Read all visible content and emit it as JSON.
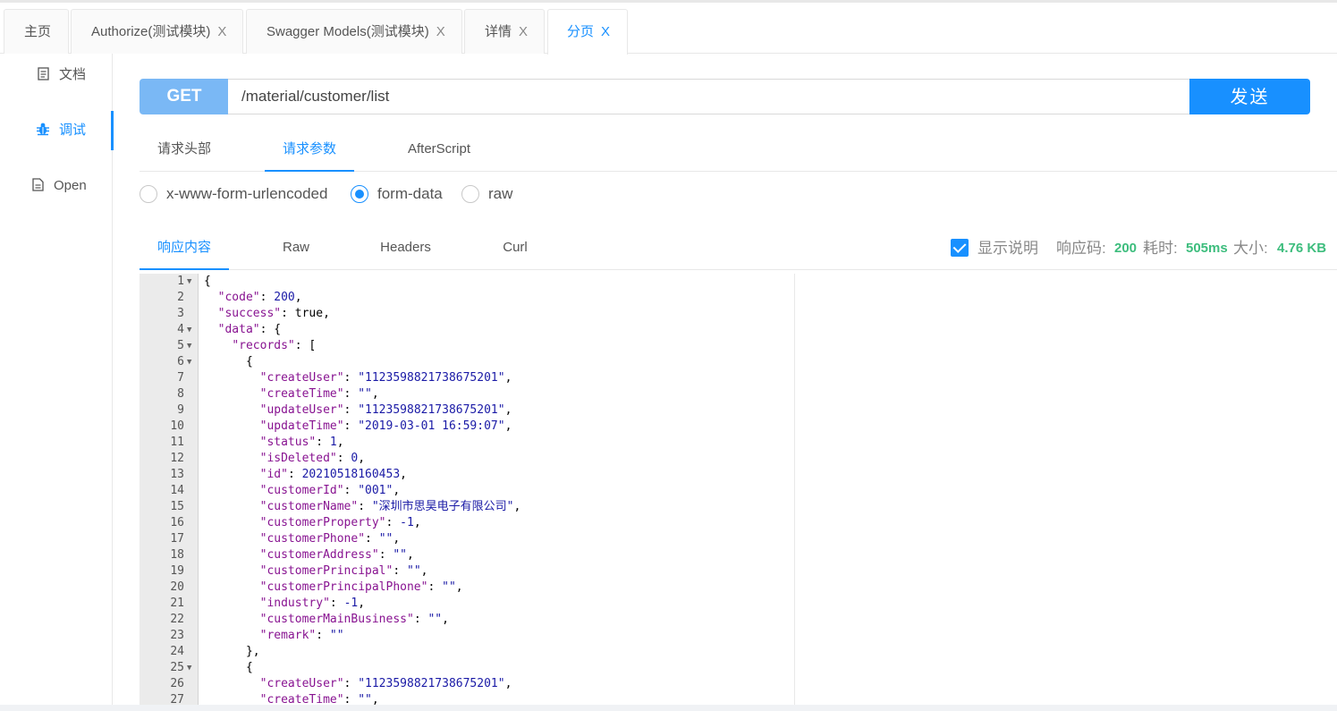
{
  "tabs": [
    {
      "label": "主页",
      "closable": false
    },
    {
      "label": "Authorize(测试模块)",
      "closable": true
    },
    {
      "label": "Swagger Models(测试模块)",
      "closable": true
    },
    {
      "label": "详情",
      "closable": true
    },
    {
      "label": "分页",
      "closable": true,
      "active": true
    }
  ],
  "close_glyph": "X",
  "sidebar": {
    "items": [
      {
        "label": "文档",
        "icon": "document-icon"
      },
      {
        "label": "调试",
        "icon": "bug-icon",
        "active": true
      },
      {
        "label": "Open",
        "icon": "file-icon"
      }
    ]
  },
  "request": {
    "method": "GET",
    "url": "/material/customer/list",
    "send_label": "发送"
  },
  "request_tabs": [
    "请求头部",
    "请求参数",
    "AfterScript"
  ],
  "body_types": [
    {
      "label": "x-www-form-urlencoded",
      "checked": false
    },
    {
      "label": "form-data",
      "checked": true
    },
    {
      "label": "raw",
      "checked": false
    }
  ],
  "response_tabs": [
    "响应内容",
    "Raw",
    "Headers",
    "Curl"
  ],
  "response_info": {
    "show_desc_label": "显示说明",
    "show_desc_checked": true,
    "code_label": "响应码:",
    "code": "200",
    "time_label": "耗时:",
    "time": "505ms",
    "size_label": "大小:",
    "size": "4.76 KB"
  },
  "colors": {
    "accent": "#1890ff",
    "method_bg": "#7ab8f5",
    "success": "#3dbd7d"
  },
  "code_lines": [
    {
      "n": "1",
      "fold": true,
      "html": "{"
    },
    {
      "n": "2",
      "fold": false,
      "html": "  <span class=\"k\">\"code\"</span>: <span class=\"n\">200</span>,"
    },
    {
      "n": "3",
      "fold": false,
      "html": "  <span class=\"k\">\"success\"</span>: <span class=\"b\">true</span>,"
    },
    {
      "n": "4",
      "fold": true,
      "html": "  <span class=\"k\">\"data\"</span>: {"
    },
    {
      "n": "5",
      "fold": true,
      "html": "    <span class=\"k\">\"records\"</span>: ["
    },
    {
      "n": "6",
      "fold": true,
      "html": "      {"
    },
    {
      "n": "7",
      "fold": false,
      "html": "        <span class=\"k\">\"createUser\"</span>: <span class=\"s\">\"1123598821738675201\"</span>,"
    },
    {
      "n": "8",
      "fold": false,
      "html": "        <span class=\"k\">\"createTime\"</span>: <span class=\"s\">\"\"</span>,"
    },
    {
      "n": "9",
      "fold": false,
      "html": "        <span class=\"k\">\"updateUser\"</span>: <span class=\"s\">\"1123598821738675201\"</span>,"
    },
    {
      "n": "10",
      "fold": false,
      "html": "        <span class=\"k\">\"updateTime\"</span>: <span class=\"s\">\"2019-03-01 16:59:07\"</span>,"
    },
    {
      "n": "11",
      "fold": false,
      "html": "        <span class=\"k\">\"status\"</span>: <span class=\"n\">1</span>,"
    },
    {
      "n": "12",
      "fold": false,
      "html": "        <span class=\"k\">\"isDeleted\"</span>: <span class=\"n\">0</span>,"
    },
    {
      "n": "13",
      "fold": false,
      "html": "        <span class=\"k\">\"id\"</span>: <span class=\"n\">20210518160453</span>,"
    },
    {
      "n": "14",
      "fold": false,
      "html": "        <span class=\"k\">\"customerId\"</span>: <span class=\"s\">\"001\"</span>,"
    },
    {
      "n": "15",
      "fold": false,
      "html": "        <span class=\"k\">\"customerName\"</span>: <span class=\"s\">\"深圳市思昊电子有限公司\"</span>,"
    },
    {
      "n": "16",
      "fold": false,
      "html": "        <span class=\"k\">\"customerProperty\"</span>: <span class=\"n\">-1</span>,"
    },
    {
      "n": "17",
      "fold": false,
      "html": "        <span class=\"k\">\"customerPhone\"</span>: <span class=\"s\">\"\"</span>,"
    },
    {
      "n": "18",
      "fold": false,
      "html": "        <span class=\"k\">\"customerAddress\"</span>: <span class=\"s\">\"\"</span>,"
    },
    {
      "n": "19",
      "fold": false,
      "html": "        <span class=\"k\">\"customerPrincipal\"</span>: <span class=\"s\">\"\"</span>,"
    },
    {
      "n": "20",
      "fold": false,
      "html": "        <span class=\"k\">\"customerPrincipalPhone\"</span>: <span class=\"s\">\"\"</span>,"
    },
    {
      "n": "21",
      "fold": false,
      "html": "        <span class=\"k\">\"industry\"</span>: <span class=\"n\">-1</span>,"
    },
    {
      "n": "22",
      "fold": false,
      "html": "        <span class=\"k\">\"customerMainBusiness\"</span>: <span class=\"s\">\"\"</span>,"
    },
    {
      "n": "23",
      "fold": false,
      "html": "        <span class=\"k\">\"remark\"</span>: <span class=\"s\">\"\"</span>"
    },
    {
      "n": "24",
      "fold": false,
      "html": "      },"
    },
    {
      "n": "25",
      "fold": true,
      "html": "      {"
    },
    {
      "n": "26",
      "fold": false,
      "html": "        <span class=\"k\">\"createUser\"</span>: <span class=\"s\">\"1123598821738675201\"</span>,"
    },
    {
      "n": "27",
      "fold": false,
      "html": "        <span class=\"k\">\"createTime\"</span>: <span class=\"s\">\"\"</span>,"
    }
  ]
}
